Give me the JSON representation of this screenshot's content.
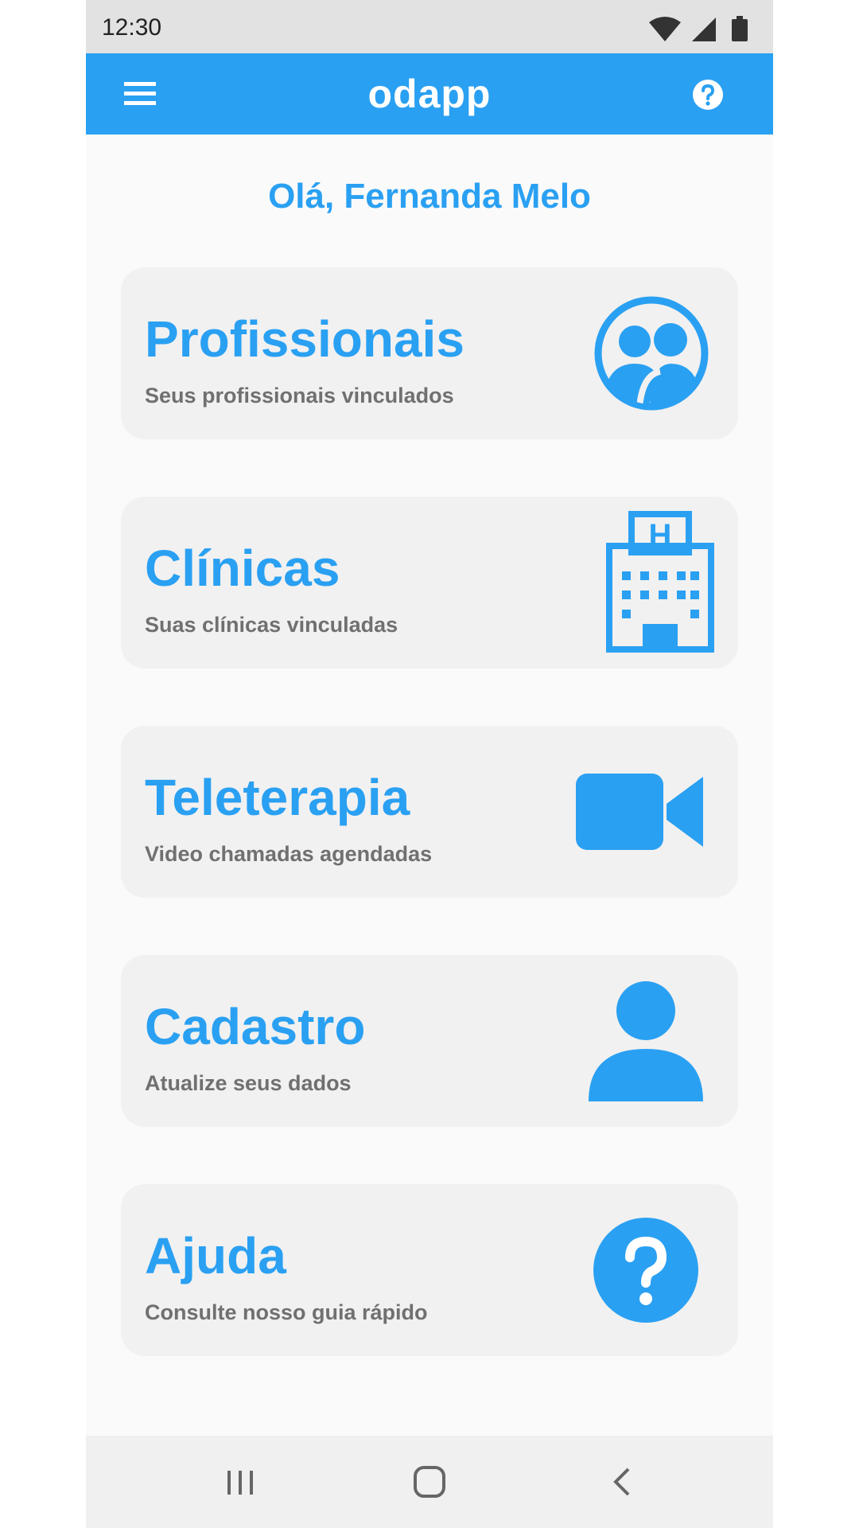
{
  "status_bar": {
    "time": "12:30",
    "icons": [
      "wifi-icon",
      "signal-icon",
      "battery-icon"
    ]
  },
  "app_bar": {
    "title": "odapp",
    "menu_icon": "menu-icon",
    "help_icon": "help-icon"
  },
  "greeting": "Olá, Fernanda Melo",
  "cards": [
    {
      "title": "Profissionais",
      "subtitle": "Seus profissionais vinculados",
      "icon": "people-icon"
    },
    {
      "title": "Clínicas",
      "subtitle": "Suas clínicas vinculadas",
      "icon": "hospital-icon"
    },
    {
      "title": "Teleterapia",
      "subtitle": "Video chamadas agendadas",
      "icon": "video-camera-icon"
    },
    {
      "title": "Cadastro",
      "subtitle": "Atualize seus dados",
      "icon": "person-icon"
    },
    {
      "title": "Ajuda",
      "subtitle": "Consulte nosso guia rápido",
      "icon": "question-icon"
    }
  ],
  "nav_bar": {
    "buttons": [
      "recent-apps-icon",
      "home-icon",
      "back-icon"
    ]
  },
  "colors": {
    "primary": "#2aa0f2",
    "card_background": "#f1f1f1",
    "subtitle": "#707070",
    "status_bar": "#e2e2e2"
  }
}
